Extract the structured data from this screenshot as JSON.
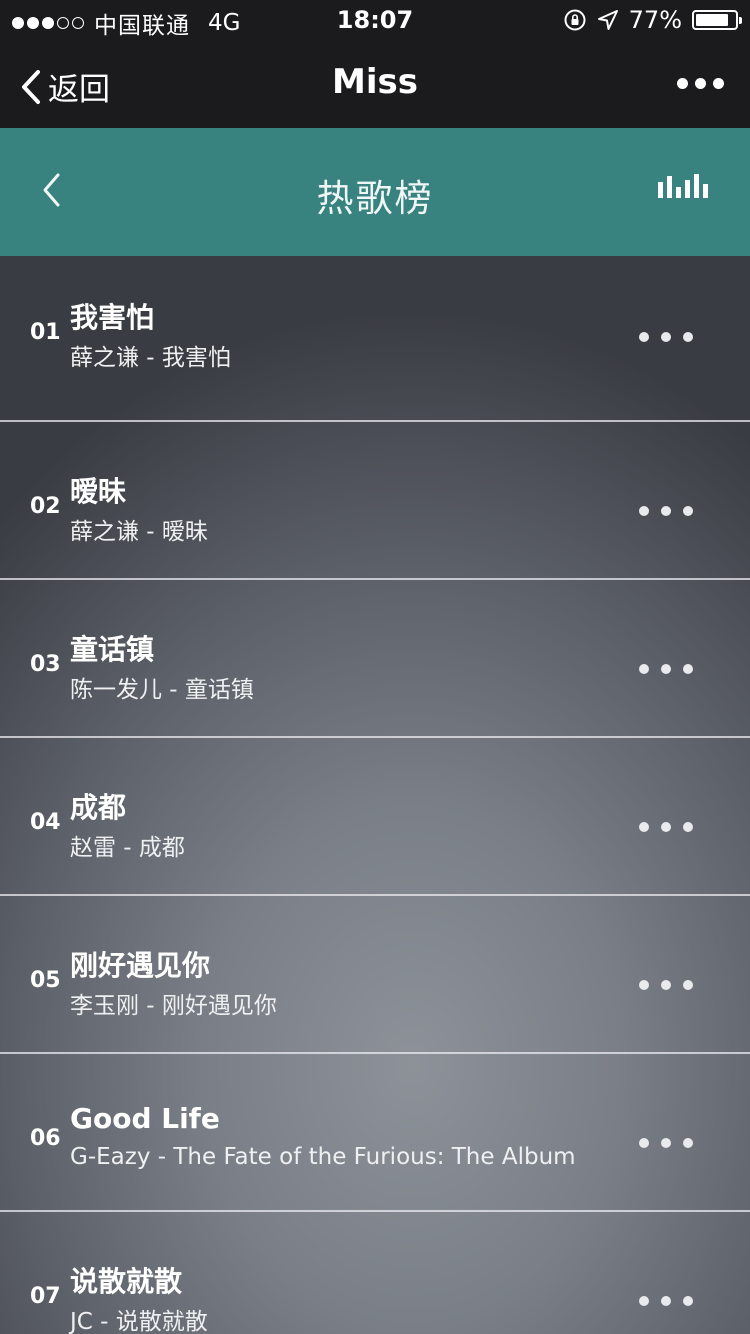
{
  "status_bar": {
    "carrier": "中国联通",
    "network": "4G",
    "time": "18:07",
    "battery": "77%",
    "battery_level": 0.77
  },
  "nav": {
    "back_label": "返回",
    "title": "Miss"
  },
  "header": {
    "title": "热歌榜",
    "accent_color": "#38827f"
  },
  "songs": [
    {
      "rank": "01",
      "title": "我害怕",
      "subtitle": "薛之谦 - 我害怕"
    },
    {
      "rank": "02",
      "title": "暧昧",
      "subtitle": "薛之谦 - 暧昧"
    },
    {
      "rank": "03",
      "title": "童话镇",
      "subtitle": "陈一发儿 - 童话镇"
    },
    {
      "rank": "04",
      "title": "成都",
      "subtitle": "赵雷 - 成都"
    },
    {
      "rank": "05",
      "title": "刚好遇见你",
      "subtitle": "李玉刚 - 刚好遇见你"
    },
    {
      "rank": "06",
      "title": "Good Life",
      "subtitle": "G-Eazy - The Fate of the Furious: The Album"
    },
    {
      "rank": "07",
      "title": "说散就散",
      "subtitle": "JC - 说散就散"
    }
  ]
}
